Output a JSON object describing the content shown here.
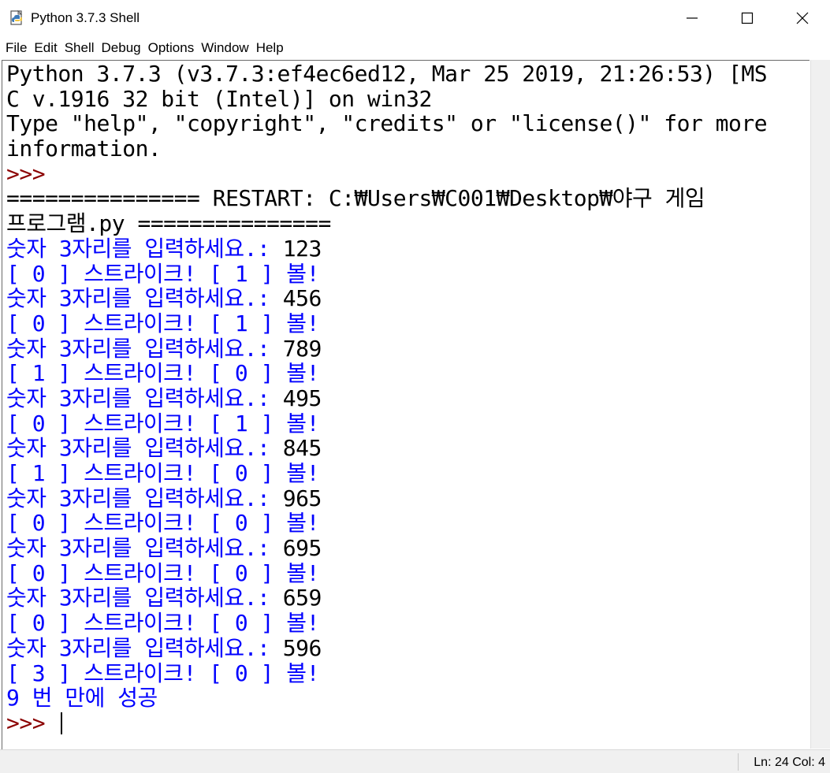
{
  "window": {
    "title": "Python 3.7.3 Shell",
    "icon": "python-idle-icon"
  },
  "window_controls": [
    "minimize-icon",
    "maximize-icon",
    "close-icon"
  ],
  "menu": {
    "items": [
      {
        "label": "File"
      },
      {
        "label": "Edit"
      },
      {
        "label": "Shell"
      },
      {
        "label": "Debug"
      },
      {
        "label": "Options"
      },
      {
        "label": "Window"
      },
      {
        "label": "Help"
      }
    ]
  },
  "shell": {
    "lines": [
      {
        "text": "Python 3.7.3 (v3.7.3:ef4ec6ed12, Mar 25 2019, 21:26:53) [MS",
        "kind": "black"
      },
      {
        "text": "C v.1916 32 bit (Intel)] on win32",
        "kind": "black"
      },
      {
        "text": "Type \"help\", \"copyright\", \"credits\" or \"license()\" for more",
        "kind": "black"
      },
      {
        "text": "information.",
        "kind": "black"
      },
      {
        "text": ">>>",
        "kind": "red"
      },
      {
        "text": "=============== RESTART: C:₩Users₩C001₩Desktop₩야구 게임",
        "kind": "black"
      },
      {
        "text": "프로그램.py ===============",
        "kind": "black"
      },
      {
        "prompt": "숫자 3자리를 입력하세요.: ",
        "input": "123",
        "kind": "input"
      },
      {
        "text": "[ 0 ] 스트라이크! [ 1 ] 볼!",
        "kind": "blue"
      },
      {
        "prompt": "숫자 3자리를 입력하세요.: ",
        "input": "456",
        "kind": "input"
      },
      {
        "text": "[ 0 ] 스트라이크! [ 1 ] 볼!",
        "kind": "blue"
      },
      {
        "prompt": "숫자 3자리를 입력하세요.: ",
        "input": "789",
        "kind": "input"
      },
      {
        "text": "[ 1 ] 스트라이크! [ 0 ] 볼!",
        "kind": "blue"
      },
      {
        "prompt": "숫자 3자리를 입력하세요.: ",
        "input": "495",
        "kind": "input"
      },
      {
        "text": "[ 0 ] 스트라이크! [ 1 ] 볼!",
        "kind": "blue"
      },
      {
        "prompt": "숫자 3자리를 입력하세요.: ",
        "input": "845",
        "kind": "input"
      },
      {
        "text": "[ 1 ] 스트라이크! [ 0 ] 볼!",
        "kind": "blue"
      },
      {
        "prompt": "숫자 3자리를 입력하세요.: ",
        "input": "965",
        "kind": "input"
      },
      {
        "text": "[ 0 ] 스트라이크! [ 0 ] 볼!",
        "kind": "blue"
      },
      {
        "prompt": "숫자 3자리를 입력하세요.: ",
        "input": "695",
        "kind": "input"
      },
      {
        "text": "[ 0 ] 스트라이크! [ 0 ] 볼!",
        "kind": "blue"
      },
      {
        "prompt": "숫자 3자리를 입력하세요.: ",
        "input": "659",
        "kind": "input"
      },
      {
        "text": "[ 0 ] 스트라이크! [ 0 ] 볼!",
        "kind": "blue"
      },
      {
        "prompt": "숫자 3자리를 입력하세요.: ",
        "input": "596",
        "kind": "input"
      },
      {
        "text": "[ 3 ] 스트라이크! [ 0 ] 볼!",
        "kind": "blue"
      },
      {
        "text": "9 번 만에 성공",
        "kind": "blue"
      },
      {
        "text": ">>> ",
        "kind": "prompt-cursor"
      }
    ]
  },
  "colors": {
    "stdout": "#0000ff",
    "prompt": "#8b0000",
    "stdin": "#000000"
  },
  "status": {
    "text": "Ln: 24 Col: 4"
  }
}
